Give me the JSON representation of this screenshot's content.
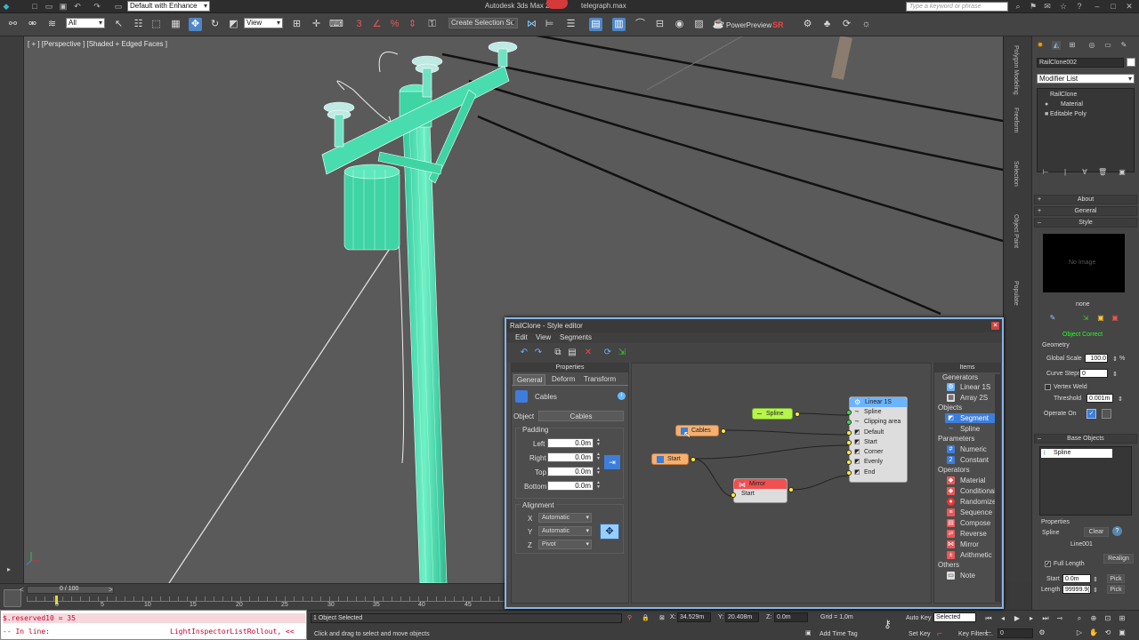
{
  "titlebar": {
    "workspace": "Default with Enhance",
    "app_title": "Autodesk 3ds Max 2014",
    "file_name": "telegraph.max",
    "search_placeholder": "Type a keyword or phrase"
  },
  "toolbar": {
    "selection_filter": "All",
    "reference_coord": "View",
    "named_selection": "Create Selection Se",
    "power_preview": "PowerPreview",
    "power_preview_badge": "SR"
  },
  "viewport": {
    "label": "[ + ] [Perspective ] [Shaded + Edged Faces ]"
  },
  "command_panel": {
    "vertical_tabs": [
      "Polygon Modeling",
      "Freeform",
      "Selection",
      "Object Paint",
      "Populate"
    ],
    "object_name": "RailClone002",
    "modifier_list": "Modifier List",
    "stack": [
      "RailClone",
      "Material",
      "Editable Poly"
    ],
    "rollouts": {
      "about": "About",
      "general": "General",
      "style": "Style",
      "base_objects": "Base Objects",
      "properties": "Properties"
    },
    "no_image": "No Image",
    "style_name": "none",
    "object_correct": "Object Correct",
    "geometry_label": "Geometry",
    "global_scale_label": "Global Scale",
    "global_scale_value": "100.0",
    "global_scale_unit": "%",
    "curve_steps_label": "Curve Steps",
    "curve_steps_value": "0",
    "vertex_weld_label": "Vertex Weld",
    "threshold_label": "Threshold",
    "threshold_value": "0.001m",
    "operate_on_label": "Operate On",
    "base_object_item": "Spline",
    "prop_spline_label": "Spline",
    "clear_label": "Clear",
    "line_value": "Line001",
    "full_length_label": "Full Length",
    "realign_label": "Realign",
    "start_label": "Start",
    "start_value": "0.0m",
    "length_label": "Length",
    "length_value": "99999.9(",
    "pick_label": "Pick"
  },
  "timeline": {
    "frame_display": "0 / 100",
    "ticks": [
      "0",
      "5",
      "10",
      "15",
      "20",
      "25",
      "30",
      "35",
      "40",
      "45"
    ]
  },
  "maxscript": {
    "line1": "$.reserved10 = 35",
    "line2_prefix": "-- In line:",
    "line2_suffix": "LightInspectorListRollout, <<"
  },
  "status": {
    "selected": "1 Object Selected",
    "prompt": "Click and drag to select and move objects",
    "x_value": "34.529m",
    "y_value": "20.408m",
    "z_value": "0.0m",
    "grid": "Grid = 1,0m",
    "auto_key": "Auto Key",
    "set_key": "Set Key",
    "selected_combo": "Selected",
    "key_filters": "Key Filters...",
    "add_time_tag": "Add Time Tag",
    "frame_value": "0"
  },
  "editor": {
    "title": "RailClone - Style editor",
    "menu": [
      "Edit",
      "View",
      "Segments"
    ],
    "properties": {
      "title": "Properties",
      "tabs": [
        "General",
        "Deform",
        "Transform"
      ],
      "name": "Cables",
      "object_label": "Object",
      "object_value": "Cables",
      "padding_label": "Padding",
      "left_label": "Left",
      "right_label": "Right",
      "top_label": "Top",
      "bottom_label": "Bottom",
      "left_value": "0.0m",
      "right_value": "0.0m",
      "top_value": "0.0m",
      "bottom_value": "0.0m",
      "alignment_label": "Alignment",
      "x_label": "X",
      "y_label": "Y",
      "z_label": "Z",
      "x_value": "Automatic",
      "y_value": "Automatic",
      "z_value": "Pivot"
    },
    "nodes": {
      "spline": "Spline",
      "cables": "Cables",
      "start": "Start",
      "mirror": "Mirror",
      "mirror_start": "Start",
      "linear_title": "Linear 1S",
      "linear_rows": [
        "Spline",
        "Clipping area",
        "Default",
        "Start",
        "Corner",
        "Evenly",
        "End"
      ]
    },
    "items": {
      "title": "Items",
      "categories": {
        "generators": "Generators",
        "objects": "Objects",
        "parameters": "Parameters",
        "operators": "Operators",
        "others": "Others"
      },
      "generators": [
        "Linear 1S",
        "Array 2S"
      ],
      "objects": [
        "Segment",
        "Spline"
      ],
      "parameters": [
        "Numeric",
        "Constant"
      ],
      "operators": [
        "Material",
        "Conditional",
        "Randomize",
        "Sequence",
        "Compose",
        "Reverse",
        "Mirror",
        "Arithmetic"
      ],
      "others": [
        "Note"
      ]
    }
  }
}
